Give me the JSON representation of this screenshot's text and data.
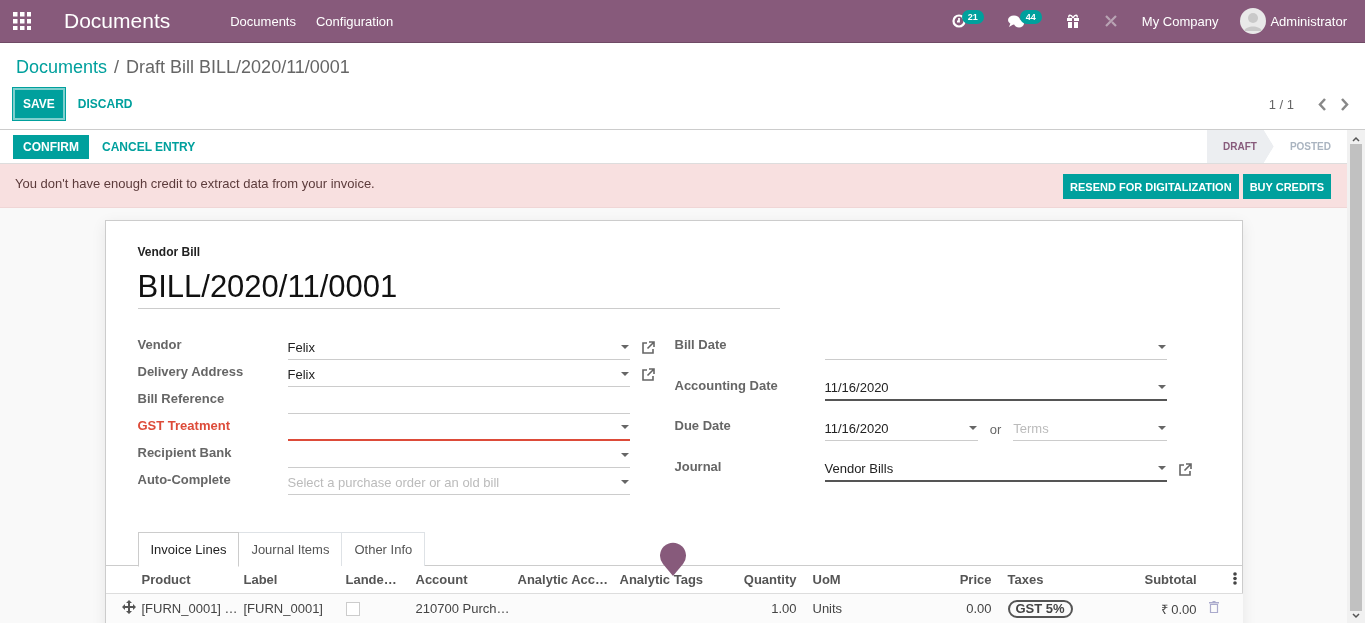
{
  "navbar": {
    "app_name": "Documents",
    "menu": [
      {
        "label": "Documents"
      },
      {
        "label": "Configuration"
      }
    ],
    "activity_count": "21",
    "message_count": "44",
    "company": "My Company",
    "user": "Administrator"
  },
  "breadcrumb": {
    "items": [
      {
        "label": "Documents",
        "kind": "link"
      },
      {
        "label": "Draft Bill BILL/2020/11/0001",
        "kind": "current"
      }
    ],
    "separator": "/"
  },
  "actions": [
    {
      "label": "SAVE",
      "kind": "primary"
    },
    {
      "label": "DISCARD",
      "kind": "link"
    }
  ],
  "pager": "1 / 1",
  "header_buttons": [
    {
      "label": "CONFIRM",
      "kind": "primary"
    },
    {
      "label": "CANCEL ENTRY",
      "kind": "link"
    }
  ],
  "statusbar": [
    {
      "label": "DRAFT",
      "selected": true
    },
    {
      "label": "POSTED",
      "selected": false
    }
  ],
  "alert": {
    "message": "You don't have enough credit to extract data from your invoice.",
    "buttons": [
      {
        "label": "RESEND FOR DIGITALIZATION"
      },
      {
        "label": "BUY CREDITS"
      }
    ]
  },
  "form": {
    "type_label": "Vendor Bill",
    "name": "BILL/2020/11/0001",
    "left_fields": [
      {
        "label": "Vendor",
        "kind": "select",
        "value": "Felix",
        "external_link": true,
        "required": false,
        "invalid": false
      },
      {
        "label": "Delivery Address",
        "kind": "select",
        "value": "Felix",
        "external_link": true,
        "required": false,
        "invalid": false
      },
      {
        "label": "Bill Reference",
        "kind": "text",
        "external_link": false,
        "required": false,
        "invalid": false
      },
      {
        "label": "GST Treatment",
        "kind": "select",
        "external_link": false,
        "required": false,
        "invalid": true
      },
      {
        "label": "Recipient Bank",
        "kind": "select",
        "external_link": false,
        "required": false,
        "invalid": false
      },
      {
        "label": "Auto-Complete",
        "kind": "select",
        "placeholder": "Select a purchase order or an old bill",
        "external_link": false,
        "required": false,
        "invalid": false
      }
    ],
    "right_fields": [
      {
        "label": "Bill Date",
        "kind": "select",
        "external_link": false,
        "required": false,
        "invalid": false
      },
      {
        "label": "Accounting Date",
        "kind": "select",
        "value": "11/16/2020",
        "external_link": false,
        "required": true,
        "invalid": false
      },
      {
        "label": "Due Date",
        "kind": "date_terms",
        "value": "11/16/2020",
        "separator": "or",
        "terms_placeholder": "Terms",
        "external_link": false,
        "required": false,
        "invalid": false
      },
      {
        "label": "Journal",
        "kind": "select",
        "value": "Vendor Bills",
        "external_link": true,
        "required": true,
        "invalid": false
      }
    ]
  },
  "tabs": [
    {
      "label": "Invoice Lines",
      "selected": true
    },
    {
      "label": "Journal Items",
      "selected": false
    },
    {
      "label": "Other Info",
      "selected": false
    }
  ],
  "table": {
    "columns": [
      {
        "label": "Product"
      },
      {
        "label": "Label"
      },
      {
        "label": "Lande…"
      },
      {
        "label": "Account"
      },
      {
        "label": "Analytic Acc…"
      },
      {
        "label": "Analytic Tags"
      },
      {
        "label": "Quantity"
      },
      {
        "label": "UoM"
      },
      {
        "label": "Price"
      },
      {
        "label": "Taxes"
      },
      {
        "label": "Subtotal"
      }
    ],
    "rows": [
      {
        "cells": [
          {
            "kind": "text",
            "text": "[FURN_0001] …"
          },
          {
            "kind": "text",
            "text": "[FURN_0001]"
          },
          {
            "kind": "checkbox",
            "checked": false
          },
          {
            "kind": "text",
            "text": "210700 Purch…"
          },
          {
            "kind": "empty"
          },
          {
            "kind": "empty"
          },
          {
            "kind": "text",
            "text": "1.00"
          },
          {
            "kind": "text",
            "text": "Units"
          },
          {
            "kind": "text",
            "text": "0.00"
          },
          {
            "kind": "tag",
            "text": "GST 5%"
          },
          {
            "kind": "text",
            "text": "₹ 0.00"
          }
        ]
      }
    ]
  }
}
